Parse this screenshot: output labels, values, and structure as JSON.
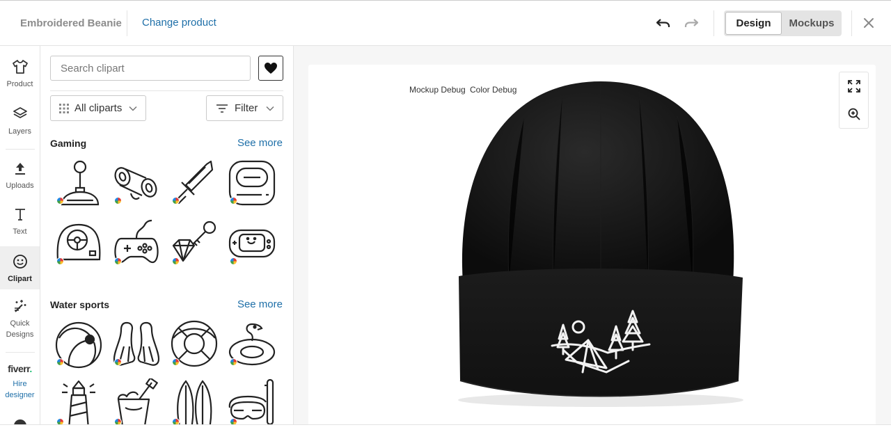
{
  "header": {
    "product_name": "Embroidered Beanie",
    "change_product": "Change product",
    "mode_options": [
      "Design",
      "Mockups"
    ],
    "active_mode": "Design"
  },
  "rail": {
    "items": [
      {
        "label": "Product",
        "icon": "shirt-icon"
      },
      {
        "label": "Layers",
        "icon": "layers-icon"
      },
      {
        "label": "Uploads",
        "icon": "upload-icon"
      },
      {
        "label": "Text",
        "icon": "text-icon"
      },
      {
        "label": "Clipart",
        "icon": "smiley-icon",
        "active": true
      },
      {
        "label": "Quick Designs",
        "icon": "magic-wand-icon"
      },
      {
        "label": "Hire designer",
        "icon": "fiverr-logo"
      }
    ],
    "fiverr_logo_text": "fiverr",
    "fiverr_logo_dot": "."
  },
  "clipart": {
    "search_placeholder": "Search clipart",
    "all_cliparts": "All cliparts",
    "filter": "Filter",
    "sections": [
      {
        "title": "Gaming",
        "see_more": "See more",
        "items": [
          "joystick-icon",
          "controller-icon",
          "sword-icon",
          "console-icon",
          "steering-wheel-icon",
          "gamepad-icon",
          "gem-key-icon",
          "handheld-console-icon"
        ]
      },
      {
        "title": "Water sports",
        "see_more": "See more",
        "items": [
          "beach-ball-icon",
          "swim-fins-icon",
          "life-ring-icon",
          "flamingo-float-icon",
          "lighthouse-icon",
          "sand-bucket-icon",
          "surfboards-icon",
          "snorkel-mask-icon"
        ]
      }
    ]
  },
  "canvas": {
    "debug_links": [
      "Mockup Debug",
      "Color Debug"
    ],
    "product_color": "#151515",
    "embroidery_color": "#f2f2f2"
  },
  "colors": {
    "link": "#1e6fa8",
    "fiverr_green": "#1dbf73"
  }
}
